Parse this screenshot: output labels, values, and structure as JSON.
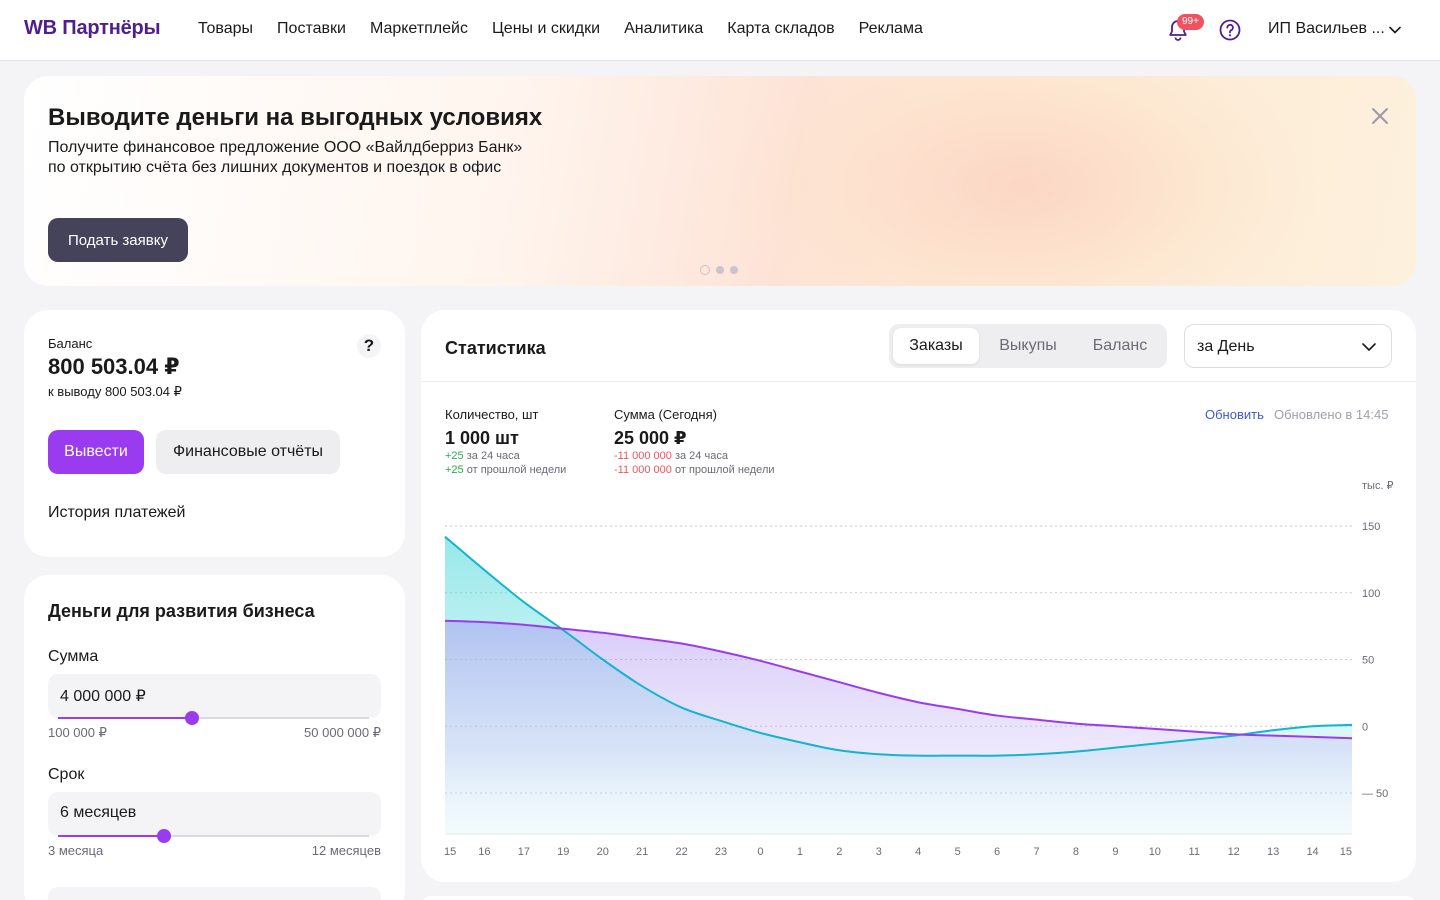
{
  "header": {
    "logo": "WB Партнёры",
    "nav": [
      "Товары",
      "Поставки",
      "Маркетплейс",
      "Цены и скидки",
      "Аналитика",
      "Карта складов",
      "Реклама"
    ],
    "notifications_badge": "99+",
    "account": "ИП Васильев ...",
    "icons": [
      "bell-icon",
      "help-circle-icon",
      "chevron-down-icon"
    ]
  },
  "banner": {
    "title": "Выводите деньги на выгодных условиях",
    "text_line1": "Получите финансовое предложение ООО «Вайлдберриз Банк»",
    "text_line2": "по открытию счёта без лишних документов и поездок в офис",
    "button": "Подать заявку",
    "slides": 3,
    "active_slide": 1
  },
  "balance": {
    "label": "Баланс",
    "value": "800 503.04 ₽",
    "sub": "к выводу 800 503.04 ₽",
    "help": "?",
    "withdraw_button": "Вывести",
    "reports_button": "Финансовые отчёты",
    "history_link": "История платежей"
  },
  "business": {
    "title": "Деньги для развития бизнеса",
    "amount_label": "Сумма",
    "amount_value": "4 000 000 ₽",
    "amount_fraction": 0.43,
    "amount_min": "100 000 ₽",
    "amount_max": "50 000 000 ₽",
    "term_label": "Срок",
    "term_value": "6 месяцев",
    "term_fraction": 0.34,
    "term_min": "3 месяца",
    "term_max": "12 месяцев"
  },
  "stats": {
    "title": "Статистика",
    "tabs": [
      "Заказы",
      "Выкупы",
      "Баланс"
    ],
    "active_tab": 0,
    "period": "за День",
    "qty_label": "Количество, шт",
    "qty_value": "1 000 шт",
    "qty_delta_day": "+25",
    "qty_delta_day_text": "за 24 часа",
    "qty_delta_week": "+25",
    "qty_delta_week_text": "от прошлой недели",
    "sum_label": "Сумма (Сегодня)",
    "sum_value": "25 000 ₽",
    "sum_delta_day": "-11 000 000",
    "sum_delta_day_text": "за 24 часа",
    "sum_delta_week": "-11 000 000",
    "sum_delta_week_text": "от прошлой недели",
    "refresh": "Обновить",
    "updated": "Обновлено в 14:45",
    "unit": "тыс. ₽"
  },
  "chart_data": {
    "type": "area",
    "categories": [
      "15",
      "16",
      "17",
      "19",
      "20",
      "21",
      "22",
      "23",
      "0",
      "1",
      "2",
      "3",
      "4",
      "5",
      "6",
      "7",
      "8",
      "9",
      "10",
      "11",
      "12",
      "13",
      "14",
      "15"
    ],
    "y_ticks": [
      "150",
      "100",
      "50",
      "0",
      "— 50"
    ],
    "ylim": [
      -50,
      150
    ],
    "series": [
      {
        "color": "#12b5cc",
        "values": [
          142,
          117,
          93,
          72,
          50,
          30,
          14,
          4,
          -5,
          -12,
          -18,
          -21,
          -22,
          -22,
          -22,
          -21,
          -19,
          -16,
          -13,
          -10,
          -7,
          -3,
          0,
          1
        ]
      },
      {
        "color": "#9a3bf0",
        "values": [
          79,
          78,
          76,
          73,
          70,
          66,
          62,
          56,
          49,
          41,
          33,
          25,
          18,
          13,
          8,
          5,
          2,
          0,
          -2,
          -4,
          -6,
          -7,
          -8,
          -9
        ]
      }
    ],
    "grid": true,
    "legend": "none"
  }
}
